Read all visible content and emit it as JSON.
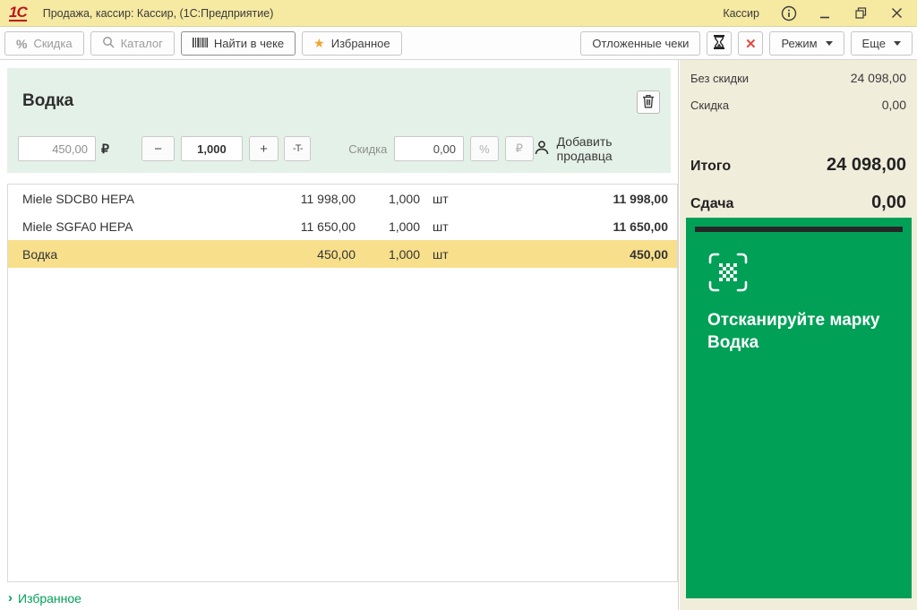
{
  "window": {
    "logo_text": "1С",
    "title": "Продажа, кассир: Кассир,  (1С:Предприятие)",
    "user": "Кассир"
  },
  "toolbar": {
    "discount": "Скидка",
    "catalog": "Каталог",
    "find_in_receipt": "Найти в чеке",
    "favorites": "Избранное",
    "deferred_receipts": "Отложенные чеки",
    "mode": "Режим",
    "more": "Еще"
  },
  "product_panel": {
    "title": "Водка",
    "price": "450,00",
    "currency": "₽",
    "minus": "−",
    "quantity": "1,000",
    "plus": "+",
    "tqty": "-T-",
    "discount_label": "Скидка",
    "discount_value": "0,00",
    "percent": "%",
    "ruble": "₽",
    "add_seller": "Добавить продавца"
  },
  "receipt": {
    "rows": [
      {
        "name": "Miele SDCB0 HEPA",
        "price": "11 998,00",
        "qty": "1,000",
        "unit": "шт",
        "total": "11 998,00",
        "selected": false
      },
      {
        "name": "Miele SGFA0 HEPA",
        "price": "11 650,00",
        "qty": "1,000",
        "unit": "шт",
        "total": "11 650,00",
        "selected": false
      },
      {
        "name": "Водка",
        "price": "450,00",
        "qty": "1,000",
        "unit": "шт",
        "total": "450,00",
        "selected": true
      }
    ]
  },
  "totals": {
    "no_discount_label": "Без скидки",
    "no_discount_value": "24 098,00",
    "discount_label": "Скидка",
    "discount_value": "0,00",
    "total_label": "Итого",
    "total_value": "24 098,00",
    "change_label": "Сдача",
    "change_value": "0,00"
  },
  "scan_panel": {
    "line1": "Отсканируйте марку",
    "line2": "Водка"
  },
  "footer": {
    "favorites": "Избранное",
    "chevron": "›"
  },
  "colors": {
    "titlebar": "#F6E9A2",
    "accent_green": "#00A057",
    "selected_row": "#F8DF8C",
    "right_panel": "#F1EDDB",
    "product_panel": "#E4F1E8",
    "logo_red": "#C4111C",
    "star_orange": "#EFA32F",
    "close_red": "#E04B3F"
  }
}
